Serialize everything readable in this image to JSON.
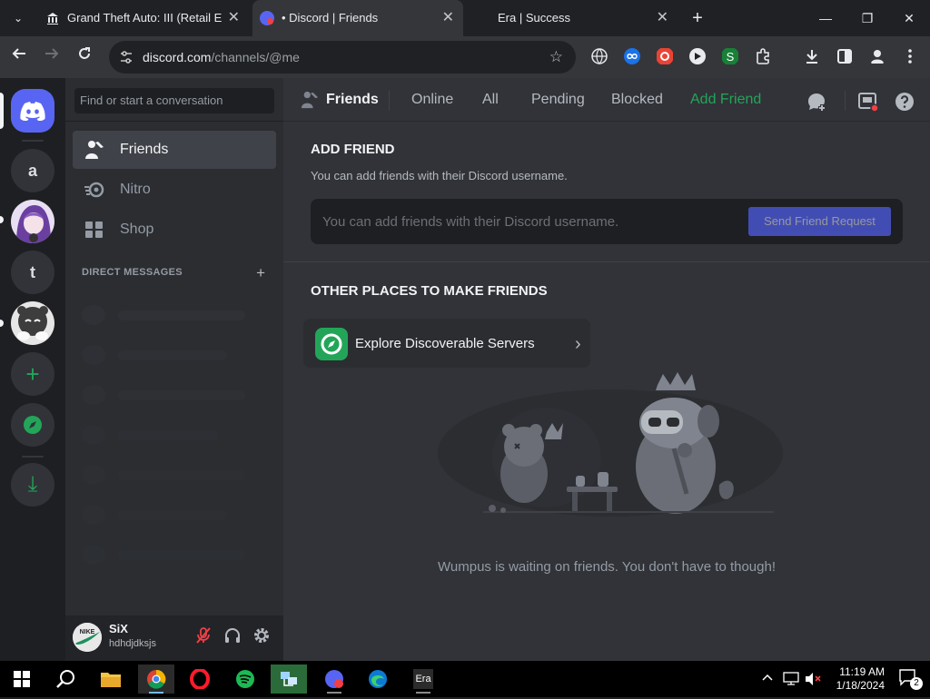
{
  "browser": {
    "tabs": [
      {
        "title": "Grand Theft Auto: III (Retail Edi",
        "active": false
      },
      {
        "title": "• Discord | Friends",
        "active": true
      },
      {
        "title": "Era | Success",
        "active": false
      }
    ],
    "url_domain": "discord.com",
    "url_path": "/channels/@me",
    "window_controls": {
      "minimize": "—",
      "restore": "❐",
      "close": "✕"
    },
    "new_tab": "+",
    "tab_close": "✕",
    "tab_dropdown": "⌄"
  },
  "servers": {
    "items": [
      {
        "label": "a",
        "kind": "letter"
      },
      {
        "label": "",
        "kind": "avatar"
      },
      {
        "label": "t",
        "kind": "letter"
      },
      {
        "label": "",
        "kind": "avatar"
      }
    ],
    "add_glyph": "+",
    "download_glyph": "⤓"
  },
  "dm_sidebar": {
    "search_placeholder": "Find or start a conversation",
    "nav": [
      {
        "label": "Friends",
        "selected": true
      },
      {
        "label": "Nitro",
        "selected": false
      },
      {
        "label": "Shop",
        "selected": false
      }
    ],
    "direct_messages_header": "DIRECT MESSAGES",
    "add_dm": "+"
  },
  "user_panel": {
    "display_name": "SiX",
    "username": "hdhdjdksjs",
    "avatar_text": "NIKE"
  },
  "header": {
    "title": "Friends",
    "tabs": [
      "Online",
      "All",
      "Pending",
      "Blocked"
    ],
    "add_friend": "Add Friend"
  },
  "add_friend_section": {
    "heading": "ADD FRIEND",
    "subtitle": "You can add friends with their Discord username.",
    "input_placeholder": "You can add friends with their Discord username.",
    "button_label": "Send Friend Request"
  },
  "other_places": {
    "heading": "OTHER PLACES TO MAKE FRIENDS",
    "explore_label": "Explore Discoverable Servers"
  },
  "empty_state": {
    "text": "Wumpus is waiting on friends. You don't have to though!"
  },
  "taskbar": {
    "era_label": "Era",
    "clock_time": "11:19 AM",
    "clock_date": "1/18/2024",
    "notification_count": "2"
  },
  "colors": {
    "blurple": "#5865f2",
    "green": "#23a559",
    "bg_main": "#313338",
    "bg_sidebar": "#2b2d31",
    "bg_rail": "#1e1f22"
  }
}
